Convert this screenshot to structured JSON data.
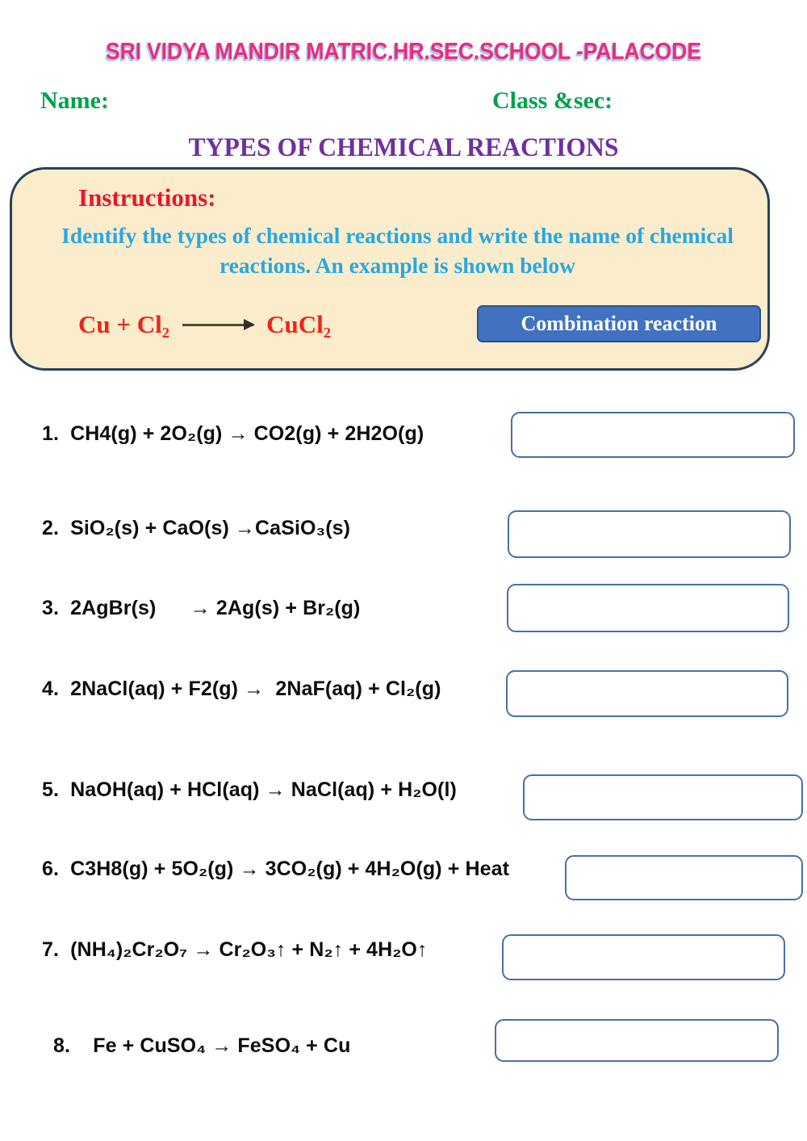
{
  "header": {
    "school_name": "SRI VIDYA MANDIR MATRIC.HR.SEC.SCHOOL -PALACODE",
    "name_label": "Name:",
    "class_label": "Class &sec:",
    "worksheet_title": "TYPES OF CHEMICAL REACTIONS"
  },
  "instructions": {
    "heading": "Instructions:",
    "body": "Identify the types of chemical reactions and write the name of chemical reactions. An example is shown below",
    "example": {
      "reactants": "Cu + Cl₂",
      "arrow": "arrow-right-icon",
      "products": "CuCl₂",
      "answer_label": "Combination reaction"
    }
  },
  "questions": [
    {
      "number": "1.",
      "equation": "CH4(g) + 2O₂(g) → CO2(g) + 2H2O(g)",
      "answer": "",
      "placeholder": ""
    },
    {
      "number": "2.",
      "equation": "SiO₂(s) + CaO(s) →CaSiO₃(s)",
      "answer": "",
      "placeholder": ""
    },
    {
      "number": "3.",
      "equation": "2AgBr(s)      → 2Ag(s) + Br₂(g)",
      "answer": "",
      "placeholder": ""
    },
    {
      "number": "4.",
      "equation": "2NaCl(aq) + F2(g) →  2NaF(aq) + Cl₂(g)",
      "answer": "",
      "placeholder": ""
    },
    {
      "number": "5.",
      "equation": "NaOH(aq) + HCl(aq) → NaCl(aq) + H₂O(l)",
      "answer": "",
      "placeholder": ""
    },
    {
      "number": "6.",
      "equation": "C3H8(g) + 5O₂(g) → 3CO₂(g) + 4H₂O(g) + Heat",
      "answer": "",
      "placeholder": ""
    },
    {
      "number": "7.",
      "equation": "(NH₄)₂Cr₂O₇ → Cr₂O₃↑ + N₂↑ + 4H₂O↑",
      "answer": "",
      "placeholder": ""
    },
    {
      "number": "8.",
      "equation": "  Fe + CuSO₄ → FeSO₄ + Cu",
      "answer": "",
      "placeholder": ""
    }
  ],
  "colors": {
    "school_name": "#ef2b7b",
    "school_name_shadow": "#a8c4f0",
    "name_label": "#00a14b",
    "worksheet_title": "#7030a0",
    "instructions_panel_bg": "#fbeccb",
    "instructions_panel_border": "#2b4257",
    "instructions_heading": "#e8172b",
    "instructions_body": "#27a8e0",
    "example_equation": "#ef2418",
    "badge_bg": "#4271c0",
    "badge_border": "#2c4f8c",
    "badge_text": "#ffffff",
    "answer_box_border": "#4a6fa8",
    "question_text": "#0d0d0d"
  }
}
